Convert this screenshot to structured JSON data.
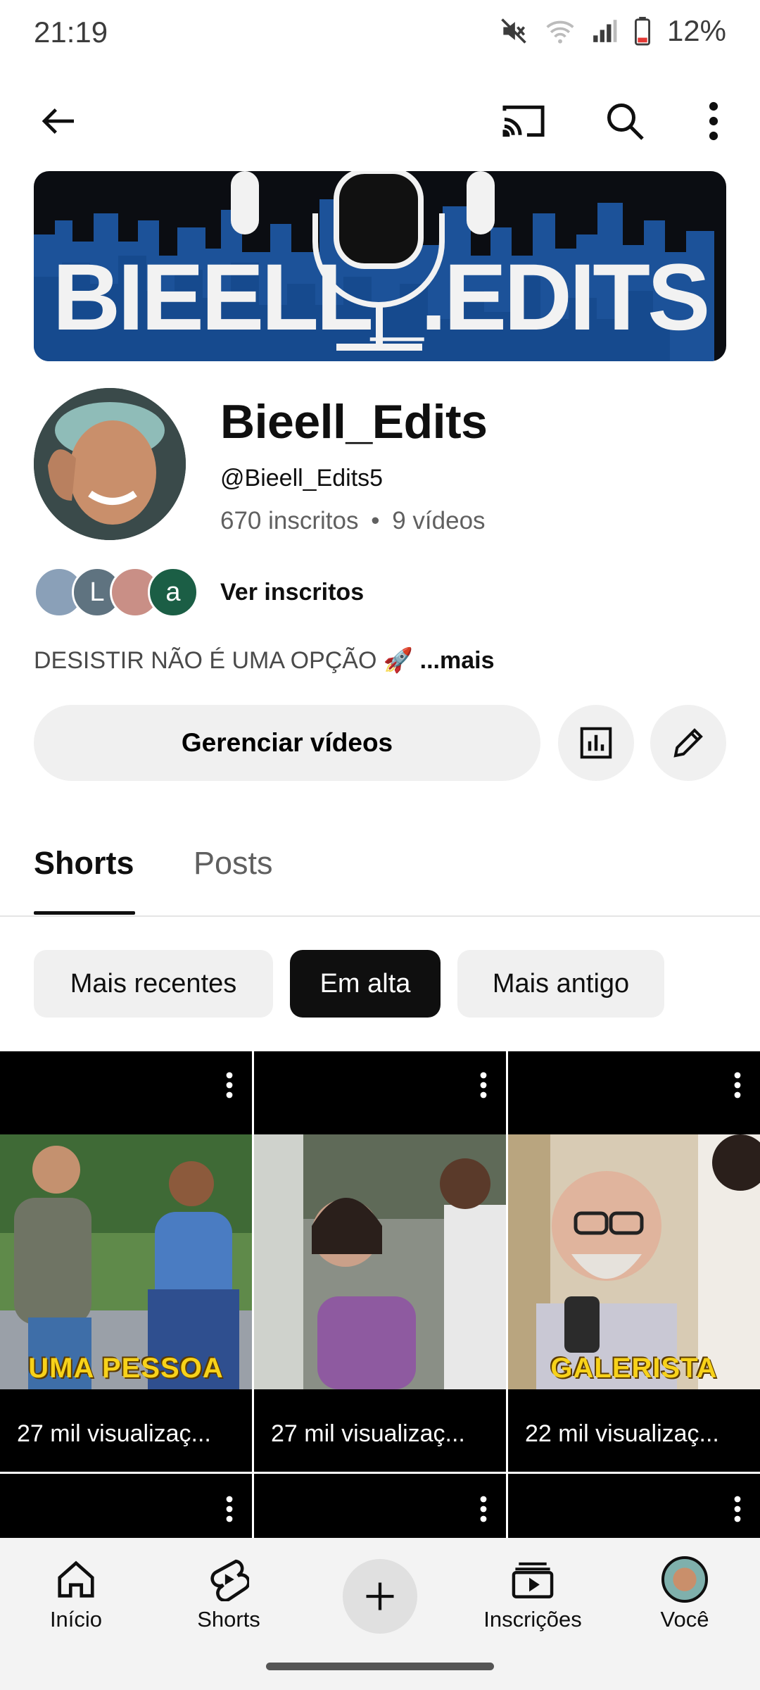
{
  "status_bar": {
    "time": "21:19",
    "battery": "12%"
  },
  "channel": {
    "banner_text": "BIEELL_.EDITS",
    "name": "Bieell_Edits",
    "handle": "@Bieell_Edits5",
    "subscribers": "670 inscritos",
    "separator": "•",
    "videos": "9 vídeos",
    "view_subscribers": "Ver inscritos",
    "subscriber_avatars": [
      {
        "letter": "",
        "color": "#8aa0b8"
      },
      {
        "letter": "L",
        "color": "#5f7380"
      },
      {
        "letter": "",
        "color": "#c98f86"
      },
      {
        "letter": "a",
        "color": "#1b5e45"
      }
    ],
    "description": "DESISTIR NÃO É UMA OPÇÃO 🚀",
    "more_label": "...mais"
  },
  "actions": {
    "manage_videos": "Gerenciar vídeos"
  },
  "tabs": [
    {
      "label": "Shorts",
      "active": true
    },
    {
      "label": "Posts",
      "active": false
    }
  ],
  "chips": [
    {
      "label": "Mais recentes",
      "active": false
    },
    {
      "label": "Em alta",
      "active": true
    },
    {
      "label": "Mais antigo",
      "active": false
    }
  ],
  "shorts": [
    {
      "views": "27 mil visualizaç...",
      "overlay": "UMA PESSOA"
    },
    {
      "views": "27 mil visualizaç...",
      "overlay": ""
    },
    {
      "views": "22 mil visualizaç...",
      "overlay": "GALERISTA"
    }
  ],
  "bottom_nav": {
    "home": "Início",
    "shorts": "Shorts",
    "subscriptions": "Inscrições",
    "you": "Você"
  },
  "colors": {
    "accent": "#0f0f0f",
    "chip_bg": "#f0f0f0",
    "muted_text": "#606060"
  }
}
